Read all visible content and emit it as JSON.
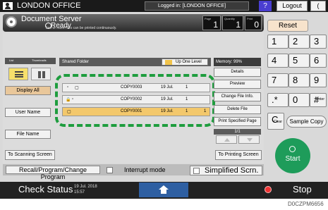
{
  "topbar": {
    "user_name": "LONDON OFFICE",
    "login_status": "Logged in: [LONDON OFFICE]",
    "help": "?",
    "logout": "Logout",
    "energy": "("
  },
  "header": {
    "title": "Document Server",
    "status": "Ready",
    "status_sub": "Two or more files can be printed continuously.",
    "page_label": "Page",
    "page_value": "1",
    "quantity_label": "Quantity",
    "quantity_value": "1",
    "print_label": "Print",
    "print_value": "0"
  },
  "keypad": {
    "reset": "Reset",
    "keys": [
      {
        "label": "1",
        "sub": ""
      },
      {
        "label": "2",
        "sub": ""
      },
      {
        "label": "3",
        "sub": ""
      },
      {
        "label": "4",
        "sub": ""
      },
      {
        "label": "5",
        "sub": ""
      },
      {
        "label": "6",
        "sub": ""
      },
      {
        "label": "7",
        "sub": ""
      },
      {
        "label": "8",
        "sub": ""
      },
      {
        "label": "9",
        "sub": ""
      },
      {
        "label": ".*",
        "sub": ""
      },
      {
        "label": "0",
        "sub": ""
      },
      {
        "label": "#",
        "sub": "Enter"
      },
      {
        "label": "C",
        "sub": "Clear"
      }
    ],
    "sample_copy": "Sample Copy",
    "start": "Start"
  },
  "view": {
    "list_tab": "List",
    "thumbnails_tab": "Thumbnails"
  },
  "sidebar": {
    "display_all": "Display All",
    "user_name": "User Name",
    "file_name": "File Name",
    "to_scanning": "To Scanning Screen"
  },
  "folder": {
    "label": "Shared Folder",
    "up_one_level": "Up One Level"
  },
  "files": [
    {
      "name": "COPY0003",
      "date": "19 Jul.",
      "pages": "1",
      "order": ""
    },
    {
      "name": "COPY0002",
      "date": "19 Jul.",
      "pages": "1",
      "order": ""
    },
    {
      "name": "COPY0001",
      "date": "19 Jul.",
      "pages": "1",
      "order": "1"
    }
  ],
  "right_panel": {
    "memory": "Memory: 99%",
    "details": "Details",
    "preview": "Preview",
    "change_file_info": "Change File Info.",
    "delete_file": "Delete File",
    "print_specified": "Print Specified Page",
    "page_indicator": "1/1",
    "to_printing": "To Printing Screen"
  },
  "toolbar": {
    "recall": "Recall/Program/Change Program",
    "interrupt": "Interrupt mode",
    "simplified": "Simplified Scrn."
  },
  "status_bar": {
    "check_status": "Check Status",
    "date": "19 Jul. 2018",
    "time": "15:57",
    "stop": "Stop"
  },
  "figure_code": "D0CZPM6656",
  "colors": {
    "selection_frame": "#1e9d3e",
    "selected_row": "#f3c86c",
    "start_button": "#1e9c5a",
    "home_button": "#2e5fa2"
  }
}
